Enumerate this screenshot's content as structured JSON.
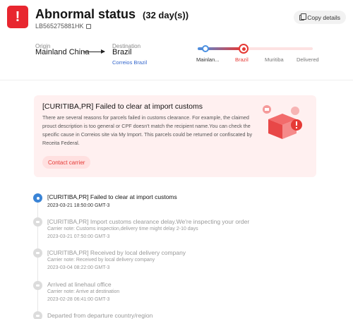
{
  "header": {
    "status_mark": "!",
    "title": "Abnormal status",
    "days": "(32 day(s))",
    "tracking_number": "LB565275881HK",
    "copy_button": "Copy details"
  },
  "route": {
    "origin_label": "Origin",
    "origin_value": "Mainland China",
    "destination_label": "Destination",
    "destination_value": "Brazil",
    "carrier_link": "Correios Brazil"
  },
  "progress": {
    "fraction_complete": 0.38,
    "stages": [
      "Mainlan...",
      "Brazil",
      "Muritiba",
      "Delivered"
    ],
    "current_stage_index": 1
  },
  "alert": {
    "title": "[CURITIBA,PR] Failed to clear at import customs",
    "body": "There are several reasons for parcels failed in customs clearance. For example, the claimed prouct description is too general or CPF doesn't match the recipient name.You can check the specific cause in Correios site via My Import. This parcels could be returned or confiscated by Receita Federal.",
    "button": "Contact carrier"
  },
  "timeline": [
    {
      "title": "[CURITIBA,PR] Failed to clear at import customs",
      "note": "",
      "time": "2023-03-21 18:50:00 GMT-3",
      "active": true
    },
    {
      "title": "[CURITIBA,PR] Import customs clearance delay.We're inspecting your order",
      "note": "Carrier note: Customs inspection,delivery time might delay 2-10 days",
      "time": "2023-03-21 07:50:00 GMT-3",
      "active": false
    },
    {
      "title": "[CURITIBA,PR] Received by local delivery company",
      "note": "Carrier note: Received by local delivery company",
      "time": "2023-03-04 08:22:00 GMT-3",
      "active": false
    },
    {
      "title": "Arrived at linehaul office",
      "note": "Carrier note: Arrive at destination",
      "time": "2023-02-28 06:41:00 GMT-3",
      "active": false
    },
    {
      "title": "Departed from departure country/region",
      "note": "",
      "time": "",
      "active": false
    }
  ],
  "colors": {
    "alert_red": "#e53935",
    "progress_blue": "#4a90e2",
    "alert_background": "#fff0f0"
  }
}
